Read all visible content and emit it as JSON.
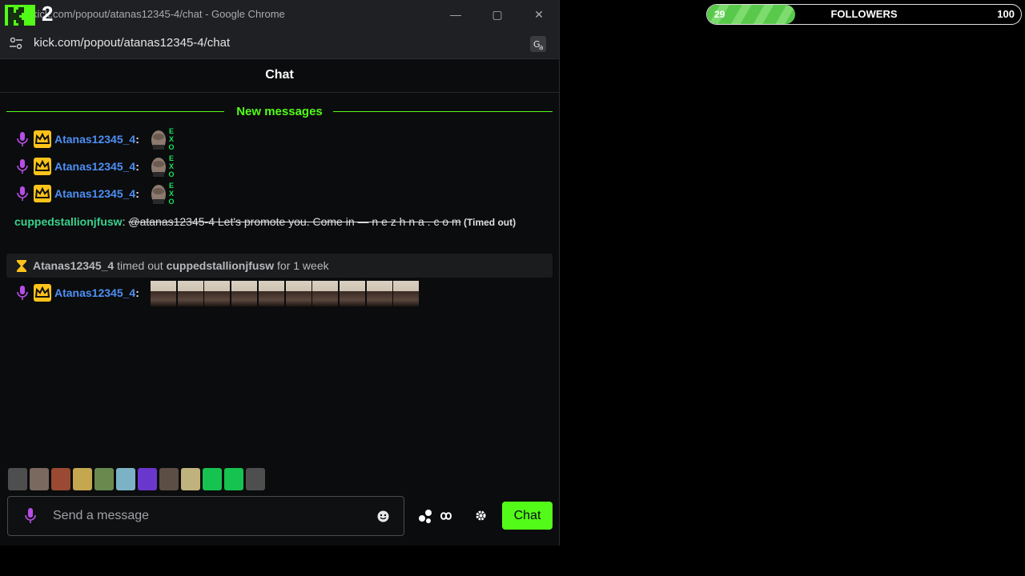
{
  "window": {
    "title": "kick.com/popout/atanas12345-4/chat - Google Chrome",
    "overlay_number": "2",
    "url": "kick.com/popout/atanas12345-4/chat",
    "minimize": "—",
    "maximize": "▢",
    "close": "✕"
  },
  "chat": {
    "header": "Chat",
    "new_messages": "New messages",
    "messages": [
      {
        "user": "Atanas12345_4",
        "sep": ":",
        "emote": "EXO"
      },
      {
        "user": "Atanas12345_4",
        "sep": ":",
        "emote": "EXO"
      },
      {
        "user": "Atanas12345_4",
        "sep": ":",
        "emote": "EXO"
      }
    ],
    "spam": {
      "user": "cuppedstallionjfusw",
      "sep": ": ",
      "text": "@atanas12345-4 Let's promote you. Come in — n e z h n a . c o m",
      "status": " (Timed out)"
    },
    "timeout": {
      "moderator": "Atanas12345_4",
      "action": " timed out ",
      "target": "cuppedstallionjfusw",
      "duration": " for 1 week"
    },
    "last_message": {
      "user": "Atanas12345_4",
      "sep": ":",
      "thumb_count": 10
    },
    "emote_bar": [
      "emote-1",
      "emote-2",
      "emote-3",
      "emote-4",
      "emote-5",
      "emote-6",
      "emote-7",
      "emote-8",
      "emote-9",
      "emote-10",
      "emote-11",
      "emote-12"
    ],
    "input_placeholder": "Send a message",
    "send_label": "Chat"
  },
  "followers": {
    "current": "29",
    "label": "FOLLOWERS",
    "goal": "100",
    "progress": 0.29
  },
  "colors": {
    "accent": "#53fc18",
    "username": "#4d8ff5",
    "spam_user": "#37d38e",
    "mic": "#b84de8",
    "crown": "#ffc31a"
  }
}
